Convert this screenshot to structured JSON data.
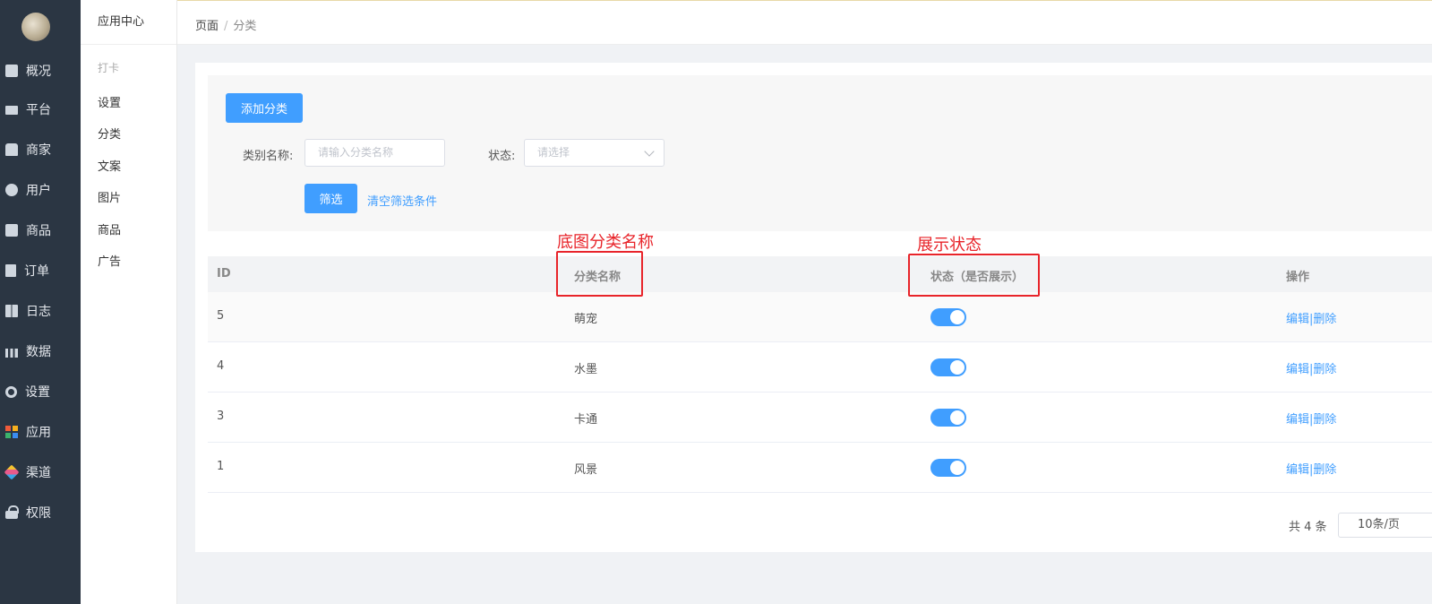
{
  "colors": {
    "sidebar_bg": "#2b3643",
    "primary": "#409eff",
    "annotation": "#e8242a"
  },
  "sidebar": {
    "items": [
      {
        "label": "概况",
        "icon": "monitor-chart-icon"
      },
      {
        "label": "平台",
        "icon": "screen-icon"
      },
      {
        "label": "商家",
        "icon": "shop-icon"
      },
      {
        "label": "用户",
        "icon": "user-icon"
      },
      {
        "label": "商品",
        "icon": "bag-icon"
      },
      {
        "label": "订单",
        "icon": "document-icon"
      },
      {
        "label": "日志",
        "icon": "book-icon"
      },
      {
        "label": "数据",
        "icon": "bar-chart-icon"
      },
      {
        "label": "设置",
        "icon": "gear-icon"
      },
      {
        "label": "应用",
        "icon": "app-grid-icon"
      },
      {
        "label": "渠道",
        "icon": "cube-icon"
      },
      {
        "label": "权限",
        "icon": "lock-icon"
      }
    ]
  },
  "submenu": {
    "title": "应用中心",
    "group": "打卡",
    "items": [
      "设置",
      "分类",
      "文案",
      "图片",
      "商品",
      "广告"
    ]
  },
  "breadcrumb": {
    "root": "页面",
    "sep": "/",
    "current": "分类"
  },
  "filter": {
    "add_button": "添加分类",
    "name_label": "类别名称:",
    "name_placeholder": "请输入分类名称",
    "status_label": "状态:",
    "status_placeholder": "请选择",
    "search_button": "筛选",
    "clear_link": "清空筛选条件"
  },
  "table": {
    "headers": [
      "ID",
      "分类名称",
      "状态（是否展示）",
      "操作"
    ],
    "rows": [
      {
        "id": "5",
        "name": "萌宠",
        "status_on": true
      },
      {
        "id": "4",
        "name": "水墨",
        "status_on": true
      },
      {
        "id": "3",
        "name": "卡通",
        "status_on": true
      },
      {
        "id": "1",
        "name": "风景",
        "status_on": true
      }
    ],
    "edit_label": "编辑",
    "delete_label": "删除",
    "op_sep": "|"
  },
  "annotations": {
    "name_note": "底图分类名称",
    "status_note": "展示状态"
  },
  "pagination": {
    "total": "共 4 条",
    "page_size": "10条/页"
  }
}
